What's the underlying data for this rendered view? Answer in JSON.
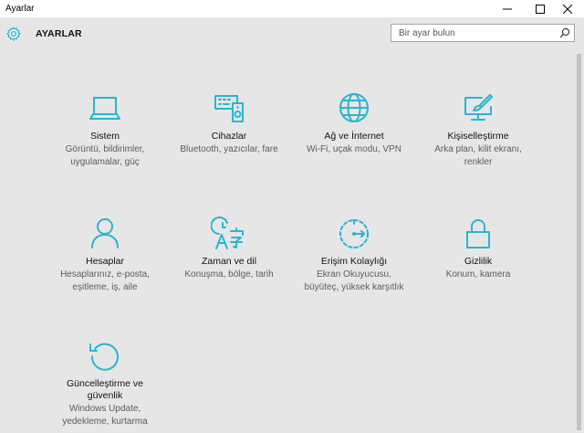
{
  "window": {
    "title": "Ayarlar"
  },
  "header": {
    "title": "AYARLAR"
  },
  "search": {
    "placeholder": "Bir ayar bulun"
  },
  "colors": {
    "accent": "#2bb5cf",
    "background": "#e6e6e6"
  },
  "tiles": [
    {
      "icon": "laptop-icon",
      "name": "Sistem",
      "desc1": "Görüntü, bildirimler,",
      "desc2": "uygulamalar, güç"
    },
    {
      "icon": "devices-icon",
      "name": "Cihazlar",
      "desc1": "Bluetooth, yazıcılar, fare",
      "desc2": ""
    },
    {
      "icon": "globe-icon",
      "name": "Ağ ve İnternet",
      "desc1": "Wi-Fi, uçak modu, VPN",
      "desc2": ""
    },
    {
      "icon": "paint-icon",
      "name": "Kişiselleştirme",
      "desc1": "Arka plan, kilit ekranı,",
      "desc2": "renkler"
    },
    {
      "icon": "person-icon",
      "name": "Hesaplar",
      "desc1": "Hesaplarınız, e-posta,",
      "desc2": "eşitleme, iş, aile"
    },
    {
      "icon": "time-language-icon",
      "name": "Zaman ve dil",
      "desc1": "Konuşma, bölge, tarih",
      "desc2": ""
    },
    {
      "icon": "accessibility-icon",
      "name": "Erişim Kolaylığı",
      "desc1": "Ekran Okuyucusu,",
      "desc2": "büyüteç, yüksek karşıtlık"
    },
    {
      "icon": "lock-icon",
      "name": "Gizlilik",
      "desc1": "Konum, kamera",
      "desc2": ""
    },
    {
      "icon": "update-icon",
      "name": "Güncelleştirme ve",
      "name2": "güvenlik",
      "desc1": "Windows Update,",
      "desc2": "yedekleme, kurtarma"
    }
  ]
}
